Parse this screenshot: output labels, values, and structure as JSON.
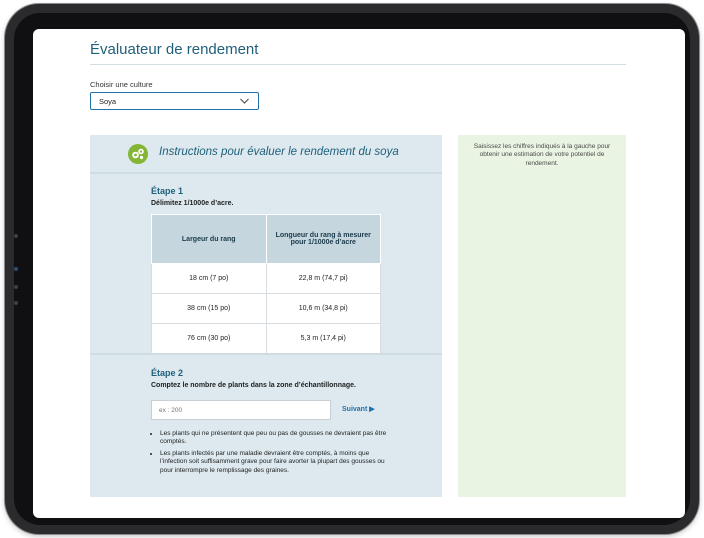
{
  "app": {
    "title": "Évaluateur de rendement",
    "crop_label": "Choisir une culture",
    "crop_selected": "Soya"
  },
  "instructions": {
    "title": "Instructions pour évaluer le rendement du soya",
    "step1": {
      "title": "Étape 1",
      "description": "Délimitez 1/1000e d’acre.",
      "headers": [
        "Largeur du rang",
        "Longueur du rang à mesurer pour 1/1000e d’acre"
      ],
      "rows": [
        [
          "18 cm (7 po)",
          "22,8 m (74,7 pi)"
        ],
        [
          "38 cm (15 po)",
          "10,6 m (34,8 pi)"
        ],
        [
          "76 cm (30 po)",
          "5,3 m (17,4 pi)"
        ]
      ]
    },
    "step2": {
      "title": "Étape 2",
      "description": "Comptez le nombre de plants dans la zone d’échantillonnage.",
      "input_placeholder": "ex : 200",
      "next_label": "Suivant ▶",
      "bullets": [
        "Les plants qui ne présentent que peu ou pas de gousses ne devraient pas être comptés.",
        "Les plants infectés par une maladie devraient être comptés, à moins que l’infection soit suffisamment grave pour faire avorter la plupart des gousses ou pour interrompre le remplissage des graines."
      ]
    }
  },
  "result_panel": {
    "text": "Saisissez les chiffres indiqués à la gauche pour obtenir une estimation de votre potentiel de rendement."
  },
  "colors": {
    "accent": "#1f5f7a",
    "instructions_bg": "#dde9ee",
    "result_bg": "#e9f4e2",
    "icon_green": "#84b535"
  }
}
